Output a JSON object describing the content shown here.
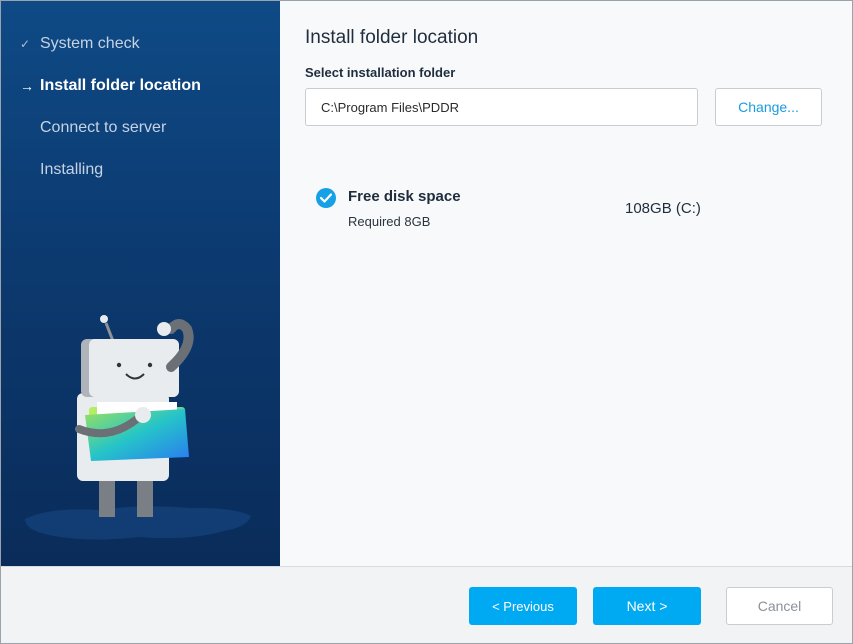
{
  "sidebar": {
    "steps": [
      {
        "label": "System check",
        "mark": "✓",
        "state": "done"
      },
      {
        "label": "Install folder location",
        "mark": "→",
        "state": "active"
      },
      {
        "label": "Connect to server",
        "mark": "",
        "state": "pending"
      },
      {
        "label": "Installing",
        "mark": "",
        "state": "pending"
      }
    ]
  },
  "main": {
    "title": "Install folder location",
    "folder_label": "Select installation folder",
    "folder_path": "C:\\Program Files\\PDDR",
    "change_label": "Change...",
    "disk": {
      "title": "Free disk space",
      "required": "Required 8GB",
      "value": "108GB (C:)",
      "status_icon": "check-circle-icon"
    }
  },
  "footer": {
    "previous_label": "< Previous",
    "next_label": "Next >",
    "cancel_label": "Cancel"
  },
  "colors": {
    "accent": "#00aaf3",
    "sidebar_top": "#0f4a86",
    "sidebar_bottom": "#0a2c5a",
    "check": "#16a1e6"
  }
}
